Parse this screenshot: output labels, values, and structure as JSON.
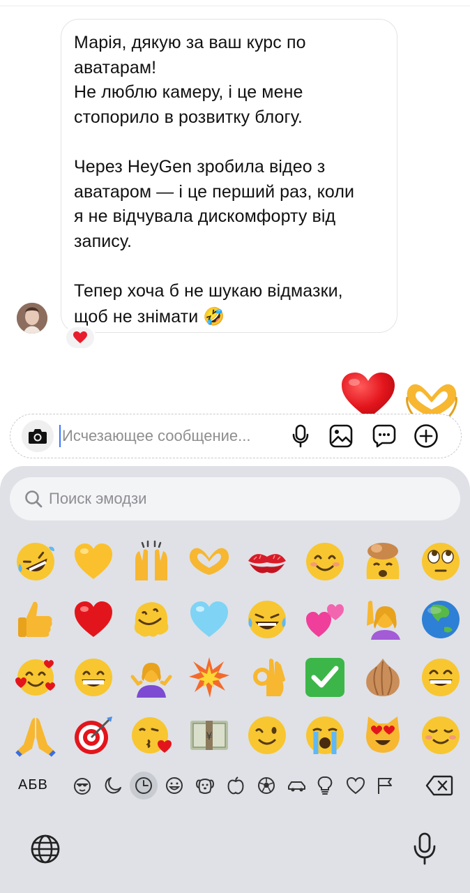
{
  "message": {
    "paragraphs": [
      [
        "Марія, дякую за ваш курс по",
        "аватарам!",
        "Не люблю камеру, і це мене",
        "стопорило в розвитку блогу."
      ],
      [
        "Через HeyGen зробила відео з",
        "аватаром — і це перший раз, коли",
        "я не відчувала дискомфорту від",
        "запису."
      ],
      [
        "Тепер хоча б не шукаю відмазки,",
        "щоб не знімати"
      ]
    ],
    "trailing_emoji": "🤣",
    "reaction": "❤️"
  },
  "outgoing": {
    "emoji": [
      "❤️",
      "🫶"
    ]
  },
  "composer": {
    "placeholder": "Исчезающее сообщение...",
    "icons": [
      "camera-icon",
      "microphone-icon",
      "image-icon",
      "sticker-chat-icon",
      "plus-icon"
    ]
  },
  "keyboard": {
    "search_placeholder": "Поиск эмодзи",
    "abc_label": "АБВ",
    "categories": [
      "recent-face-icon",
      "moon-icon",
      "clock-icon",
      "smiley-icon",
      "dog-icon",
      "apple-icon",
      "ball-icon",
      "car-icon",
      "bulb-icon",
      "heart-icon",
      "flag-icon"
    ],
    "active_category": "clock-icon",
    "emoji_rows": [
      [
        "🤣",
        "💛",
        "🙌",
        "🫶",
        "💋",
        "😊",
        "🤯",
        "🙄"
      ],
      [
        "👍",
        "❤️",
        "🫠",
        "🩵",
        "😂",
        "💕",
        "🙋‍♀️",
        "🌏"
      ],
      [
        "🥰",
        "😁",
        "🤷‍♀️",
        "💥",
        "👌",
        "✅",
        "🧅",
        "😄"
      ],
      [
        "🙏",
        "🎯",
        "😘",
        "💴",
        "😉",
        "😭",
        "😻",
        "☺️"
      ]
    ]
  }
}
